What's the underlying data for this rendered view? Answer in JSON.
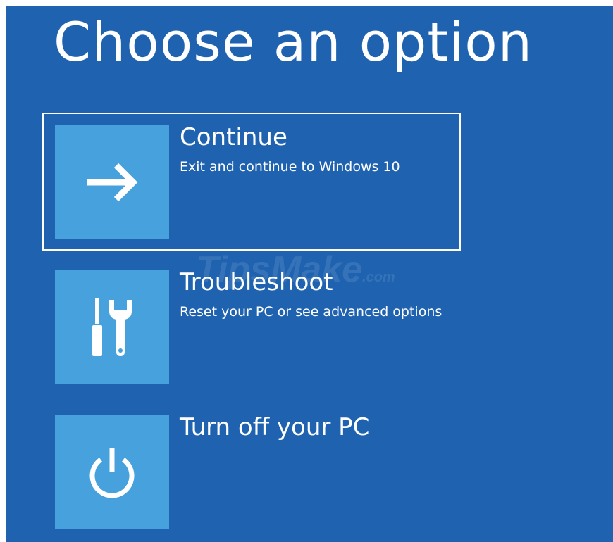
{
  "title": "Choose an option",
  "watermark": {
    "main": "TipsMake",
    "suffix": ".com"
  },
  "options": [
    {
      "label": "Continue",
      "description": "Exit and continue to Windows 10",
      "icon": "arrow-right-icon",
      "selected": true
    },
    {
      "label": "Troubleshoot",
      "description": "Reset your PC or see advanced options",
      "icon": "tools-icon",
      "selected": false
    },
    {
      "label": "Turn off your PC",
      "description": "",
      "icon": "power-icon",
      "selected": false
    }
  ],
  "colors": {
    "background": "#1f63b0",
    "tile": "#47a1dd",
    "text": "#ffffff"
  }
}
